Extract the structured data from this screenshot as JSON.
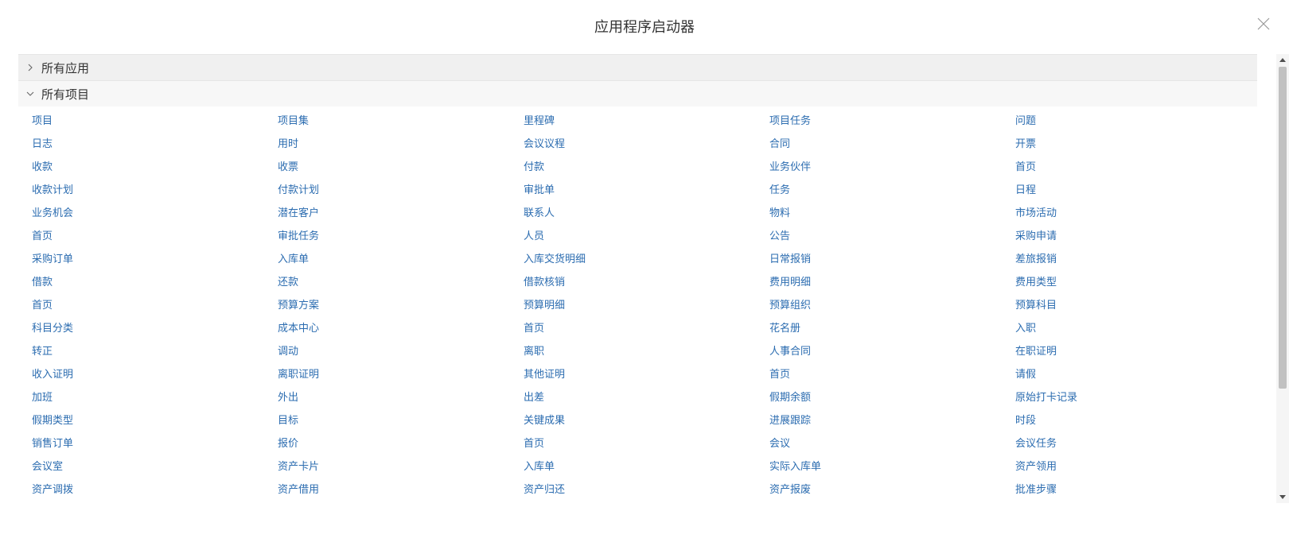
{
  "dialog": {
    "title": "应用程序启动器"
  },
  "icons": {
    "close": "close-icon",
    "collapsed": "chevron-right-icon",
    "expanded": "chevron-down-icon"
  },
  "sections": {
    "all_apps": {
      "label": "所有应用",
      "expanded": false
    },
    "all_items": {
      "label": "所有项目",
      "expanded": true,
      "items": [
        "项目",
        "项目集",
        "里程碑",
        "项目任务",
        "问题",
        "日志",
        "用时",
        "会议议程",
        "合同",
        "开票",
        "收款",
        "收票",
        "付款",
        "业务伙伴",
        "首页",
        "收款计划",
        "付款计划",
        "审批单",
        "任务",
        "日程",
        "业务机会",
        "潜在客户",
        "联系人",
        "物料",
        "市场活动",
        "首页",
        "审批任务",
        "人员",
        "公告",
        "采购申请",
        "采购订单",
        "入库单",
        "入库交货明细",
        "日常报销",
        "差旅报销",
        "借款",
        "还款",
        "借款核销",
        "费用明细",
        "费用类型",
        "首页",
        "预算方案",
        "预算明细",
        "预算组织",
        "预算科目",
        "科目分类",
        "成本中心",
        "首页",
        "花名册",
        "入职",
        "转正",
        "调动",
        "离职",
        "人事合同",
        "在职证明",
        "收入证明",
        "离职证明",
        "其他证明",
        "首页",
        "请假",
        "加班",
        "外出",
        "出差",
        "假期余额",
        "原始打卡记录",
        "假期类型",
        "目标",
        "关键成果",
        "进展跟踪",
        "时段",
        "销售订单",
        "报价",
        "首页",
        "会议",
        "会议任务",
        "会议室",
        "资产卡片",
        "入库单",
        "实际入库单",
        "资产领用",
        "资产调拨",
        "资产借用",
        "资产归还",
        "资产报废",
        "批准步骤"
      ]
    }
  },
  "colors": {
    "link": "#2b6cb0",
    "header_bg": "#f0f0f0",
    "scroll_thumb": "#c1c1c1"
  }
}
